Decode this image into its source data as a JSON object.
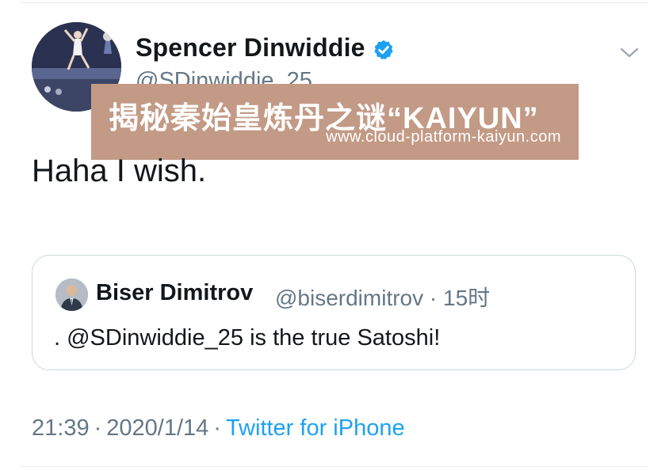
{
  "tweet": {
    "author": {
      "name": "Spencer Dinwiddie",
      "handle": "@SDinwiddie_25",
      "verified": true
    },
    "text": "Haha I wish.",
    "quoted": {
      "name": "Biser Dimitrov",
      "handle": "@biserdimitrov",
      "separator": "·",
      "time": "15时",
      "text": ". @SDinwiddie_25 is the true Satoshi!"
    },
    "footer": {
      "time": "21:39",
      "separator": "·",
      "date": "2020/1/14",
      "source": "Twitter for iPhone"
    }
  },
  "watermark": {
    "title": "揭秘秦始皇炼丹之谜“KAIYUN”",
    "url": "www.cloud-platform-kaiyun.com"
  },
  "icons": {
    "verified": "verified-badge-icon",
    "menu": "chevron-down-icon"
  },
  "colors": {
    "text": "#14171a",
    "secondary": "#657786",
    "link": "#1da1f2",
    "border": "#ccd6dd",
    "watermark_bg": "#c39a86"
  }
}
